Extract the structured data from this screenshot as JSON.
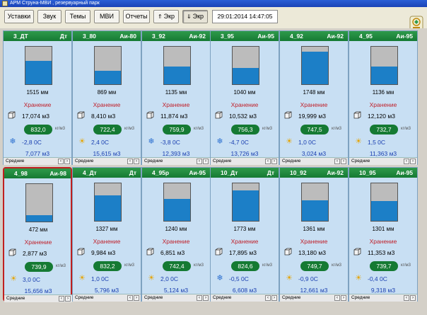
{
  "window": {
    "title": "АРМ Струна-МВИ , резервуарный парк"
  },
  "toolbar": {
    "buttons": [
      {
        "label": "Уставки",
        "icon": ""
      },
      {
        "label": "Звук",
        "icon": ""
      },
      {
        "label": "Темы",
        "icon": ""
      },
      {
        "label": "МВИ",
        "icon": ""
      },
      {
        "label": "Отчеты",
        "icon": ""
      },
      {
        "label": "Экр",
        "icon": "up-arrow-icon"
      },
      {
        "label": "Экр",
        "icon": "down-arrow-icon"
      }
    ],
    "datetime": "29:01:2014  14:47:05"
  },
  "tanks": [
    {
      "name": "3_ДТ",
      "product": "Дт",
      "level": "1515 мм",
      "status": "Хранение",
      "volume": "17,074 м3",
      "density": "832,0",
      "density_unit": "кг/м3",
      "temp": "-2,8 0С",
      "temp_icon": "snowflake-icon",
      "mass": "7,077 м3",
      "footer": "Средние",
      "fill": 0.62,
      "color_status": "#c0202a"
    },
    {
      "name": "3_80",
      "product": "Аи-80",
      "level": "869 мм",
      "status": "Хранение",
      "volume": "8,410 м3",
      "density": "722,4",
      "density_unit": "кг/м3",
      "temp": "2,4 0С",
      "temp_icon": "sun-icon",
      "mass": "15,615 м3",
      "footer": "Средние",
      "fill": 0.36,
      "color_status": "#c0202a"
    },
    {
      "name": "3_92",
      "product": "Аи-92",
      "level": "1135 мм",
      "status": "Хранение",
      "volume": "11,874 м3",
      "density": "759,9",
      "density_unit": "кг/м3",
      "temp": "-3,8 0С",
      "temp_icon": "snowflake-icon",
      "mass": "12,393 м3",
      "footer": "Средние",
      "fill": 0.48,
      "color_status": "#c0202a"
    },
    {
      "name": "3_95",
      "product": "Аи-95",
      "level": "1040 мм",
      "status": "Хранение",
      "volume": "10,532 м3",
      "density": "756,3",
      "density_unit": "кг/м3",
      "temp": "-4,7 0С",
      "temp_icon": "snowflake-icon",
      "mass": "13,726 м3",
      "footer": "Средние",
      "fill": 0.43,
      "color_status": "#c0202a"
    },
    {
      "name": "4_92",
      "product": "Аи-92",
      "level": "1748 мм",
      "status": "Хранение",
      "volume": "19,999 м3",
      "density": "747,5",
      "density_unit": "кг/м3",
      "temp": "1,0 0С",
      "temp_icon": "sun-icon",
      "mass": "3,024 м3",
      "footer": "Средние",
      "fill": 0.86,
      "color_status": "#c0202a"
    },
    {
      "name": "4_95",
      "product": "Аи-95",
      "level": "1136 мм",
      "status": "Хранение",
      "volume": "12,120 м3",
      "density": "732,7",
      "density_unit": "кг/м3",
      "temp": "1,5 0С",
      "temp_icon": "sun-icon",
      "mass": "11,363 м3",
      "footer": "Средние",
      "fill": 0.48,
      "color_status": "#c0202a"
    },
    {
      "name": "4_98",
      "product": "Аи-98",
      "level": "472 мм",
      "status": "Хранение",
      "volume": "2,877 м3",
      "density": "739,9",
      "density_unit": "кг/м3",
      "temp": "3,0 0С",
      "temp_icon": "sun-icon",
      "mass": "15,656 м3",
      "footer": "Средние",
      "fill": 0.17,
      "color_status": "#c0202a",
      "selected": true
    },
    {
      "name": "4_Дт",
      "product": "Дт",
      "level": "1327 мм",
      "status": "Хранение",
      "volume": "9,984 м3",
      "density": "832,2",
      "density_unit": "кг/м3",
      "temp": "1,0 0С",
      "temp_icon": "sun-icon",
      "mass": "5,796 м3",
      "footer": "Средние",
      "fill": 0.68,
      "color_status": "#c0202a"
    },
    {
      "name": "4_95р",
      "product": "Аи-95",
      "level": "1240 мм",
      "status": "Хранение",
      "volume": "6,851 м3",
      "density": "742,4",
      "density_unit": "кг/м3",
      "temp": "2,0 0С",
      "temp_icon": "sun-icon",
      "mass": "5,124 м3",
      "footer": "Средние",
      "fill": 0.59,
      "color_status": "#c0202a"
    },
    {
      "name": "10_Дт",
      "product": "Дт",
      "level": "1773 мм",
      "status": "Хранение",
      "volume": "17,895 м3",
      "density": "824,6",
      "density_unit": "кг/м3",
      "temp": "-0,5 0С",
      "temp_icon": "snowflake-icon",
      "mass": "6,608 м3",
      "footer": "Средние",
      "fill": 0.82,
      "color_status": "#c0202a"
    },
    {
      "name": "10_92",
      "product": "Аи-92",
      "level": "1361 мм",
      "status": "Хранение",
      "volume": "13,180 м3",
      "density": "749,7",
      "density_unit": "кг/м3",
      "temp": "-0,9 0С",
      "temp_icon": "sun-icon",
      "mass": "12,661 м3",
      "footer": "Средние",
      "fill": 0.55,
      "color_status": "#c0202a"
    },
    {
      "name": "10_95",
      "product": "Аи-95",
      "level": "1301 мм",
      "status": "Хранение",
      "volume": "11,353 м3",
      "density": "739,7",
      "density_unit": "кг/м3",
      "temp": "-0,4 0С",
      "temp_icon": "sun-icon",
      "mass": "9,318 м3",
      "footer": "Средние",
      "fill": 0.53,
      "color_status": "#c0202a"
    }
  ]
}
